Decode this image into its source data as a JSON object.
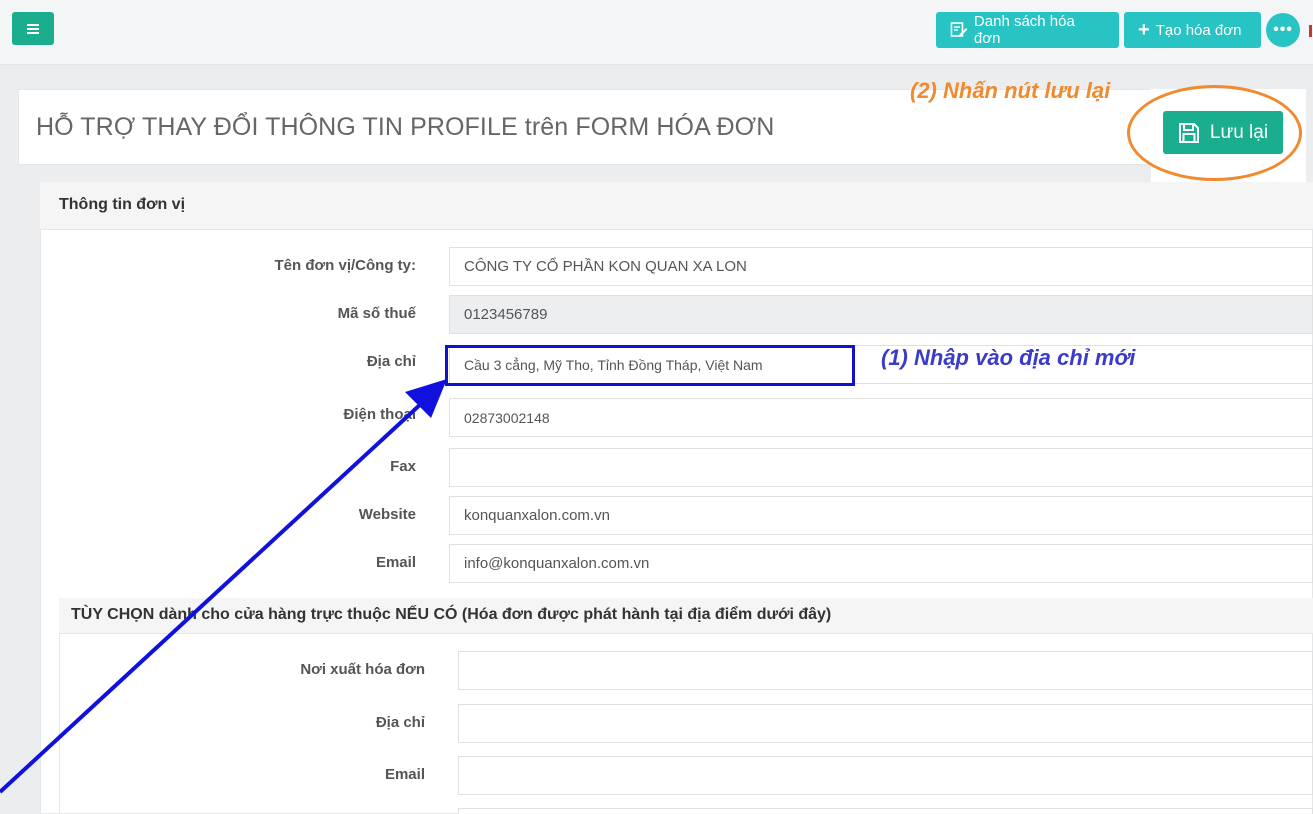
{
  "topbar": {
    "menu_icon": "hamburger-icon",
    "list_button_label": "Danh sách hóa đơn",
    "list_button_icon": "edit-list-icon",
    "create_button_label": "Tạo hóa đơn",
    "create_button_icon": "plus-icon",
    "more_icon": "ellipsis-icon"
  },
  "page": {
    "title": "HỖ TRỢ THAY ĐỔI THÔNG TIN PROFILE trên FORM HÓA ĐƠN",
    "save_label": "Lưu lại",
    "save_icon": "floppy-disk-icon"
  },
  "annotations": {
    "save_hint": "(2) Nhấn nút lưu lại",
    "address_hint": "(1) Nhập vào địa chỉ mới",
    "colors": {
      "orange": "#f08a2e",
      "blue": "#1111cc"
    }
  },
  "unit_info": {
    "header": "Thông tin đơn vị",
    "fields": [
      {
        "label": "Tên đơn vị/Công ty:",
        "value": "CÔNG TY CỔ PHẦN KON QUAN XA LON"
      },
      {
        "label": "Mã số thuế",
        "value": "0123456789"
      },
      {
        "label": "Địa chỉ",
        "value": "Cầu 3 cẳng, Mỹ Tho, Tỉnh Đồng Tháp, Việt Nam"
      },
      {
        "label": "Điện thoại",
        "value": "02873002148"
      },
      {
        "label": "Fax",
        "value": ""
      },
      {
        "label": "Website",
        "value": "konquanxalon.com.vn"
      },
      {
        "label": "Email",
        "value": "info@konquanxalon.com.vn"
      }
    ]
  },
  "branch_options": {
    "header": "TÙY CHỌN dành cho cửa hàng trực thuộc NẾU CÓ (Hóa đơn được phát hành tại địa điểm dưới đây)",
    "fields": [
      {
        "label": "Nơi xuất hóa đơn",
        "value": ""
      },
      {
        "label": "Địa chỉ",
        "value": ""
      },
      {
        "label": "Email",
        "value": ""
      },
      {
        "label": "",
        "value": ""
      }
    ]
  },
  "colors": {
    "accent": "#1aae8e",
    "teal": "#28c3c3"
  }
}
